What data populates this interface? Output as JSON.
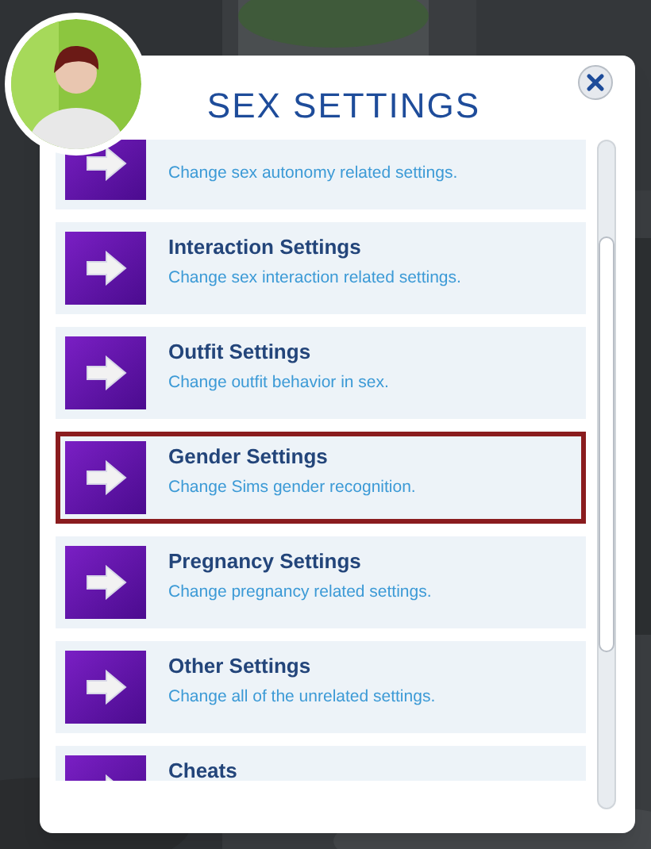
{
  "dialog": {
    "title": "SEX SETTINGS"
  },
  "items": [
    {
      "description": "Change sex autonomy related settings.",
      "selected": false
    },
    {
      "title": "Interaction Settings",
      "description": "Change sex interaction related settings.",
      "selected": false
    },
    {
      "title": "Outfit Settings",
      "description": "Change outfit behavior in sex.",
      "selected": false
    },
    {
      "title": "Gender Settings",
      "description": "Change Sims gender recognition.",
      "selected": true
    },
    {
      "title": "Pregnancy Settings",
      "description": "Change pregnancy related settings.",
      "selected": false
    },
    {
      "title": "Other Settings",
      "description": "Change all of the unrelated settings.",
      "selected": false
    },
    {
      "title": "Cheats",
      "selected": false
    }
  ]
}
